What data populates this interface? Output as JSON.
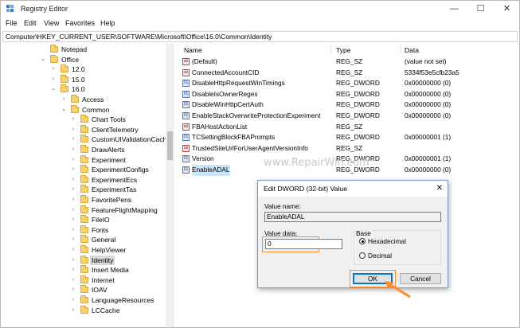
{
  "window": {
    "title": "Registry Editor",
    "controls": {
      "minimize": "—",
      "maximize": "☐",
      "close": "✕"
    }
  },
  "menu": [
    "File",
    "Edit",
    "View",
    "Favorites",
    "Help"
  ],
  "address": "Computer\\HKEY_CURRENT_USER\\SOFTWARE\\Microsoft\\Office\\16.0\\Common\\Identity",
  "tree": {
    "items": [
      {
        "label": "Notepad",
        "level": 0,
        "arrow": ""
      },
      {
        "label": "Office",
        "level": 0,
        "arrow": "⌄"
      },
      {
        "label": "12.0",
        "level": 1,
        "arrow": "›"
      },
      {
        "label": "15.0",
        "level": 1,
        "arrow": "›"
      },
      {
        "label": "16.0",
        "level": 1,
        "arrow": "⌄"
      },
      {
        "label": "Access",
        "level": 2,
        "arrow": "›"
      },
      {
        "label": "Common",
        "level": 2,
        "arrow": "⌄"
      },
      {
        "label": "Chart Tools",
        "level": 3,
        "arrow": "›"
      },
      {
        "label": "ClientTelemetry",
        "level": 3,
        "arrow": "›"
      },
      {
        "label": "CustomUIValidationCache",
        "level": 3,
        "arrow": "›"
      },
      {
        "label": "DrawAlerts",
        "level": 3,
        "arrow": "›"
      },
      {
        "label": "Experiment",
        "level": 3,
        "arrow": "›"
      },
      {
        "label": "ExperimentConfigs",
        "level": 3,
        "arrow": "›"
      },
      {
        "label": "ExperimentEcs",
        "level": 3,
        "arrow": "›"
      },
      {
        "label": "ExperimentTas",
        "level": 3,
        "arrow": "›"
      },
      {
        "label": "FavoritePens",
        "level": 3,
        "arrow": "›"
      },
      {
        "label": "FeatureFlightMapping",
        "level": 3,
        "arrow": "›"
      },
      {
        "label": "FileIO",
        "level": 3,
        "arrow": "›"
      },
      {
        "label": "Fonts",
        "level": 3,
        "arrow": "›"
      },
      {
        "label": "General",
        "level": 3,
        "arrow": "›"
      },
      {
        "label": "HelpViewer",
        "level": 3,
        "arrow": "›"
      },
      {
        "label": "Identity",
        "level": 3,
        "arrow": "›",
        "selected": true
      },
      {
        "label": "Insert Media",
        "level": 3,
        "arrow": "›"
      },
      {
        "label": "Internet",
        "level": 3,
        "arrow": "›"
      },
      {
        "label": "IOAV",
        "level": 3,
        "arrow": "›"
      },
      {
        "label": "LanguageResources",
        "level": 3,
        "arrow": "›"
      },
      {
        "label": "LCCache",
        "level": 3,
        "arrow": "›"
      }
    ]
  },
  "values": {
    "headers": {
      "name": "Name",
      "type": "Type",
      "data": "Data"
    },
    "rows": [
      {
        "kind": "sz",
        "name": "(Default)",
        "type": "REG_SZ",
        "data": "(value not set)"
      },
      {
        "kind": "sz",
        "name": "ConnectedAccountCID",
        "type": "REG_SZ",
        "data": "5334f53e5cfb23a5"
      },
      {
        "kind": "dword",
        "name": "DisableHttpRequestWinTimings",
        "type": "REG_DWORD",
        "data": "0x00000000 (0)"
      },
      {
        "kind": "dword",
        "name": "DisableIsOwnerRegex",
        "type": "REG_DWORD",
        "data": "0x00000000 (0)"
      },
      {
        "kind": "dword",
        "name": "DisableWinHttpCertAuth",
        "type": "REG_DWORD",
        "data": "0x00000000 (0)"
      },
      {
        "kind": "dword",
        "name": "EnableStackOverwriteProtectionExperiment",
        "type": "REG_DWORD",
        "data": "0x00000000 (0)"
      },
      {
        "kind": "sz",
        "name": "FBAHostActionList",
        "type": "REG_SZ",
        "data": ""
      },
      {
        "kind": "dword",
        "name": "TCSettingBlockFBAPrompts",
        "type": "REG_DWORD",
        "data": "0x00000001 (1)"
      },
      {
        "kind": "sz",
        "name": "TrustedSiteUrlForUserAgentVersionInfo",
        "type": "REG_SZ",
        "data": ""
      },
      {
        "kind": "dword",
        "name": "Version",
        "type": "REG_DWORD",
        "data": "0x00000001 (1)"
      },
      {
        "kind": "dword",
        "name": "EnableADAL",
        "type": "REG_DWORD",
        "data": "0x00000000 (0)",
        "selected": true
      }
    ]
  },
  "watermark": "www.RepairWin.com",
  "dialog": {
    "title": "Edit DWORD (32-bit) Value",
    "close": "✕",
    "value_name_label": "Value name:",
    "value_name": "EnableADAL",
    "value_data_label": "Value data:",
    "value_data": "0",
    "base_label": "Base",
    "hex_label": "Hexadecimal",
    "dec_label": "Decimal",
    "base_selected": "Hexadecimal",
    "ok": "OK",
    "cancel": "Cancel"
  },
  "colors": {
    "highlight_annotation": "#ff8c2a",
    "folder": "#f6d36d",
    "selection": "#cce4f7"
  }
}
